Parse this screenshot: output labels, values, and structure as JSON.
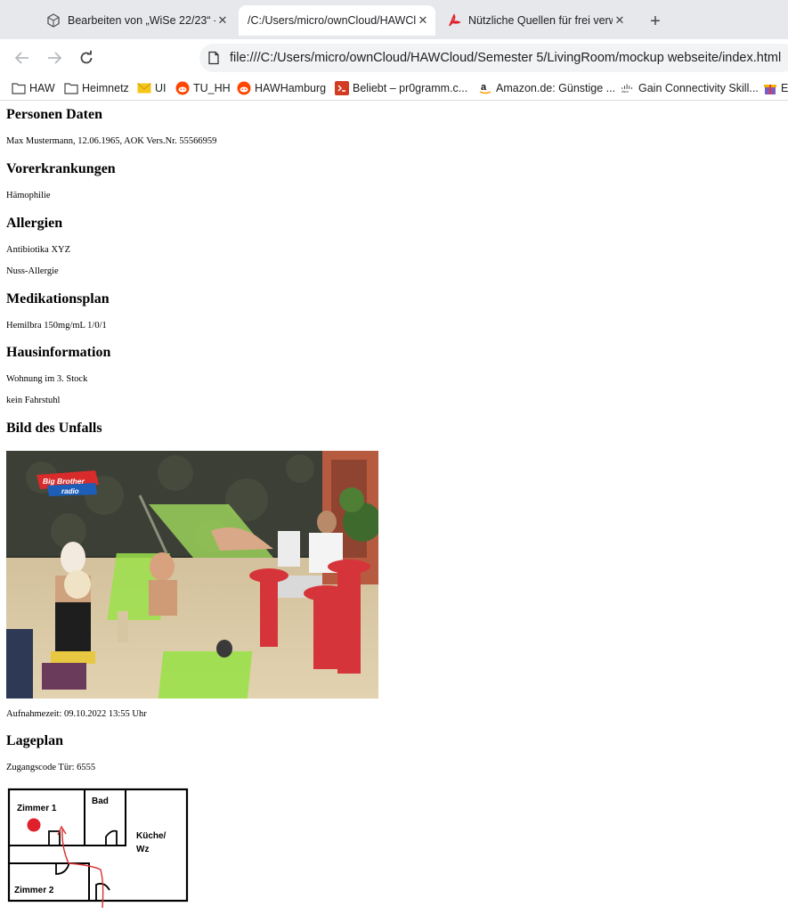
{
  "browser": {
    "tabs": [
      {
        "title": "Bearbeiten von „WiSe 22/23“ - C",
        "icon": "moodle-icon",
        "active": false
      },
      {
        "title": "/C:/Users/micro/ownCloud/HAWCl",
        "icon": "none",
        "active": true
      },
      {
        "title": "Nützliche Quellen für frei verwe",
        "icon": "acrobat-icon",
        "active": false
      }
    ],
    "url": "file:///C:/Users/micro/ownCloud/HAWCloud/Semester 5/LivingRoom/mockup webseite/index.html",
    "bookmarks": [
      {
        "label": "HAW",
        "icon": "folder-icon"
      },
      {
        "label": "Heimnetz",
        "icon": "folder-icon"
      },
      {
        "label": "UI",
        "icon": "mail-icon"
      },
      {
        "label": "TU_HH",
        "icon": "reddit-icon"
      },
      {
        "label": "HAWHamburg",
        "icon": "reddit-icon"
      },
      {
        "label": "Beliebt – pr0gramm.c...",
        "icon": "pr0-icon"
      },
      {
        "label": "Amazon.de: Günstige ...",
        "icon": "amazon-icon"
      },
      {
        "label": "Gain Connectivity Skill...",
        "icon": "cisco-icon"
      },
      {
        "label": "E",
        "icon": "gift-icon"
      }
    ]
  },
  "page": {
    "personal_heading": "Personen Daten",
    "personal_text": "Max Mustermann, 12.06.1965, AOK Vers.Nr. 55566959",
    "conditions_heading": "Vorerkrankungen",
    "conditions": [
      "Hämophilie"
    ],
    "allergies_heading": "Allergien",
    "allergies": [
      "Antibiotika XYZ",
      "Nuss-Allergie"
    ],
    "medication_heading": "Medikationsplan",
    "medication": [
      "Hemilbra 150mg/mL 1/0/1"
    ],
    "house_heading": "Hausinformation",
    "house": [
      "Wohnung im 3. Stock",
      "kein Fahrstuhl"
    ],
    "accident_heading": "Bild des Unfalls",
    "accident_photo_logo": "Big Brother radio",
    "accident_time": "Aufnahmezeit: 09.10.2022 13:55 Uhr",
    "floorplan_heading": "Lageplan",
    "door_code": "Zugangscode Tür: 6555",
    "floorplan_labels": {
      "room1": "Zimmer 1",
      "bath": "Bad",
      "kitchen_1": "Küche/",
      "kitchen_2": "Wz",
      "room2": "Zimmer 2"
    }
  },
  "colors": {
    "tabstrip": "#e6e8eb",
    "marker": "#e0202a",
    "path": "#d83030"
  }
}
